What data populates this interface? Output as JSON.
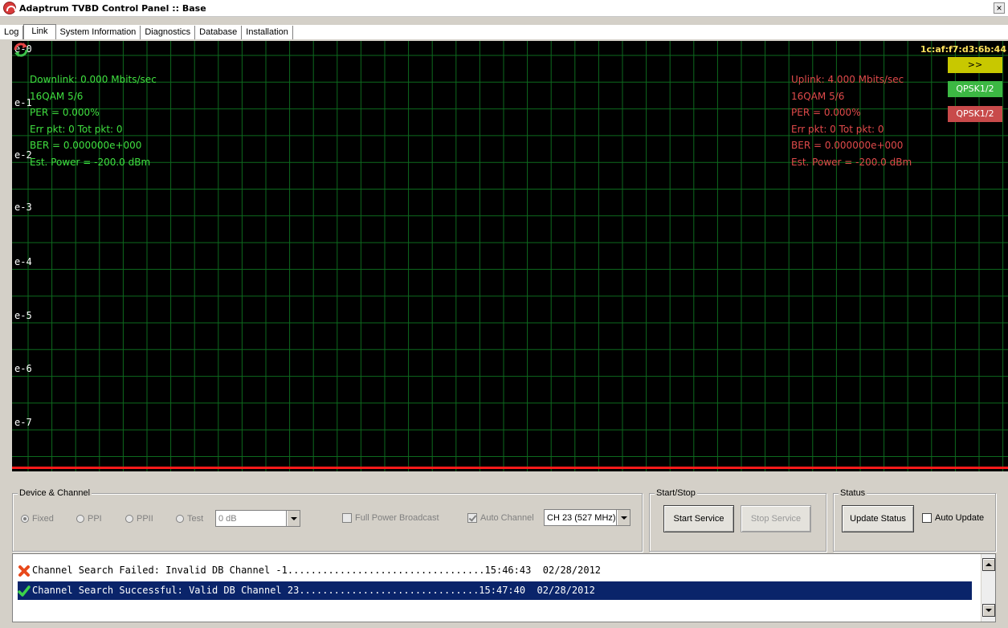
{
  "window": {
    "title": "Adaptrum TVBD Control Panel :: Base",
    "close": "×"
  },
  "tabs": [
    {
      "label": "Log"
    },
    {
      "label": "Link"
    },
    {
      "label": "System Information"
    },
    {
      "label": "Diagnostics"
    },
    {
      "label": "Database"
    },
    {
      "label": "Installation"
    }
  ],
  "plot": {
    "y_labels": [
      "e-0",
      "e-1",
      "e-2",
      "e-3",
      "e-4",
      "e-5",
      "e-6",
      "e-7"
    ],
    "mac": "1c:af:f7:d3:6b:44",
    "downlink": {
      "rate": "Downlink:  0.000 Mbits/sec",
      "modulation": "16QAM  5/6",
      "per": "PER = 0.000%",
      "err": "Err pkt: 0 Tot pkt: 0",
      "ber": "BER = 0.000000e+000",
      "power": "Est. Power = -200.0 dBm"
    },
    "uplink": {
      "rate": "Uplink: 4.000 Mbits/sec",
      "modulation": "16QAM  5/6",
      "per": "PER = 0.000%",
      "err": "Err pkt: 0 Tot pkt: 0",
      "ber": "BER = 0.000000e+000",
      "power": "Est. Power = -200.0 dBm"
    },
    "buttons": {
      "expand": ">>",
      "green": "QPSK1/2",
      "red": "QPSK1/2"
    },
    "colors": {
      "grid": "#0d6a1e",
      "downlink": "#40e040",
      "uplink": "#e04a4a",
      "baseline": "#ff1a1a"
    }
  },
  "device_channel": {
    "label": "Device & Channel",
    "radios": {
      "fixed": "Fixed",
      "ppi": "PPI",
      "ppii": "PPII",
      "test": "Test"
    },
    "test_value": "0 dB",
    "full_power": "Full Power Broadcast",
    "auto_channel": "Auto Channel",
    "channel": "CH 23 (527 MHz)"
  },
  "start_stop": {
    "label": "Start/Stop",
    "start": "Start Service",
    "stop": "Stop Service"
  },
  "status": {
    "label": "Status",
    "update": "Update Status",
    "auto_update": "Auto Update"
  },
  "log": [
    {
      "text": "Channel Search Failed: Invalid DB Channel -1..................................15:46:43  02/28/2012",
      "icon": "error-icon"
    },
    {
      "text": "Channel Search Successful: Valid DB Channel 23...............................15:47:40  02/28/2012",
      "icon": "check-icon"
    }
  ]
}
